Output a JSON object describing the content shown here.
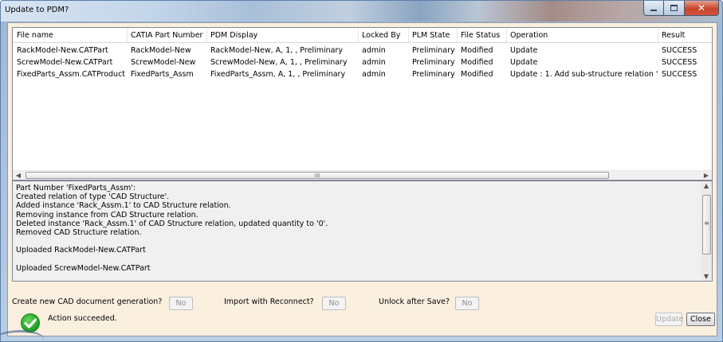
{
  "window": {
    "title": "Update to PDM?"
  },
  "grid": {
    "columns": [
      "File name",
      "CATIA Part Number",
      "PDM Display",
      "Locked By",
      "PLM State",
      "File Status",
      "Operation",
      "Result"
    ],
    "rows": [
      [
        "RackModel-New.CATPart",
        "RackModel-New",
        "RackModel-New, A, 1, , Preliminary",
        "admin",
        "Preliminary",
        "Modified",
        "Update",
        "SUCCESS"
      ],
      [
        "ScrewModel-New.CATPart",
        "ScrewModel-New",
        "ScrewModel-New, A, 1, , Preliminary",
        "admin",
        "Preliminary",
        "Modified",
        "Update",
        "SUCCESS"
      ],
      [
        "FixedParts_Assm.CATProduct",
        "FixedParts_Assm",
        "FixedParts_Assm, A, 1, , Preliminary",
        "admin",
        "Preliminary",
        "Modified",
        "Update : 1. Add sub-structure relation \"...",
        "SUCCESS"
      ]
    ],
    "hscroll_grip": "III"
  },
  "log": {
    "lines": [
      "Part Number 'FixedParts_Assm':",
      "Created relation of type 'CAD Structure'.",
      "Added instance 'Rack_Assm.1' to CAD Structure relation.",
      "Removing instance from CAD Structure relation.",
      "Deleted instance 'Rack_Assm.1' of CAD Structure relation, updated quantity to '0'.",
      "Removed CAD Structure relation.",
      "",
      "Uploaded RackModel-New.CATPart",
      "",
      "Uploaded ScrewModel-New.CATPart"
    ],
    "vscroll_grip": "≡"
  },
  "options": {
    "new_generation_label": "Create new CAD document generation?",
    "new_generation_value": "No",
    "reconnect_label": "Import with Reconnect?",
    "reconnect_value": "No",
    "unlock_label": "Unlock after Save?",
    "unlock_value": "No"
  },
  "status": {
    "message": "Action succeeded.",
    "icon": "check-icon"
  },
  "buttons": {
    "update": "Update",
    "close": "Close"
  },
  "colors": {
    "client_bg": "#fbf0df",
    "success_green": "#1c9b23",
    "close_red": "#c7442a"
  }
}
